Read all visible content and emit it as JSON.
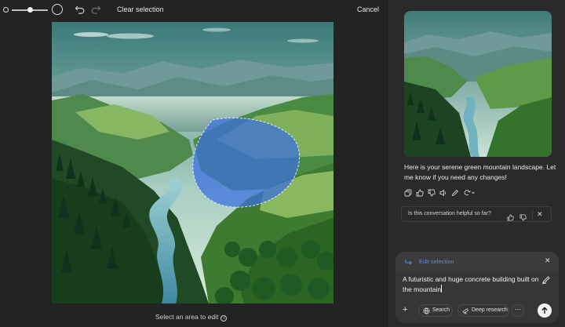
{
  "toolbar": {
    "clear_selection": "Clear selection",
    "cancel": "Cancel",
    "brush_size_fraction": 0.5
  },
  "editor": {
    "hint": "Select an area to edit",
    "hint_icon": "info-icon",
    "selection_color": "#3a6fe0"
  },
  "chat": {
    "assistant_reply": "Here is your serene green mountain landscape. Let me know if you need any changes!",
    "feedback": {
      "question": "Is this conversation helpful so far?"
    },
    "composer": {
      "edit_label": "Edit selection",
      "prompt_text": "A futuristic and huge concrete building built on the mountain",
      "search_label": "Search",
      "deep_research_label": "Deep research",
      "more_label": "⋯"
    },
    "accent_color": "#4d8cf5"
  }
}
